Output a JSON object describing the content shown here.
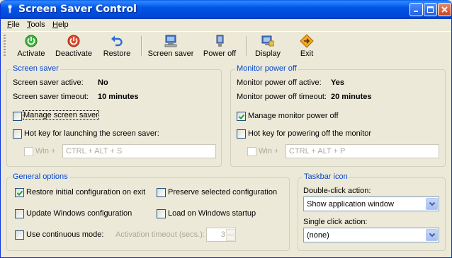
{
  "window": {
    "title": "Screen Saver Control"
  },
  "menu": [
    {
      "label": "File",
      "key": "F",
      "rest": "ile"
    },
    {
      "label": "Tools",
      "key": "T",
      "rest": "ools"
    },
    {
      "label": "Help",
      "key": "H",
      "rest": "elp"
    }
  ],
  "toolbar": {
    "activate": "Activate",
    "deactivate": "Deactivate",
    "restore": "Restore",
    "screen_saver": "Screen saver",
    "power_off": "Power off",
    "display": "Display",
    "exit": "Exit"
  },
  "screen_saver": {
    "legend": "Screen saver",
    "active_label": "Screen saver active:",
    "active_value": "No",
    "timeout_label": "Screen saver timeout:",
    "timeout_value": "10 minutes",
    "manage_label": "Manage screen saver",
    "manage_checked": false,
    "hotkey_label": "Hot key for launching the screen saver:",
    "hotkey_checked": false,
    "win_label": "Win +",
    "hotkey_value": "CTRL + ALT + S"
  },
  "monitor": {
    "legend": "Monitor power off",
    "active_label": "Monitor power off active:",
    "active_value": "Yes",
    "timeout_label": "Monitor power off timeout:",
    "timeout_value": "20 minutes",
    "manage_label": "Manage monitor power off",
    "manage_checked": true,
    "hotkey_label": "Hot key for powering off the monitor",
    "hotkey_checked": false,
    "win_label": "Win +",
    "hotkey_value": "CTRL + ALT + P"
  },
  "general": {
    "legend": "General options",
    "restore_label": "Restore initial configuration on exit",
    "restore_checked": true,
    "preserve_label": "Preserve selected configuration",
    "preserve_checked": false,
    "update_label": "Update Windows configuration",
    "update_checked": false,
    "startup_label": "Load on Windows startup",
    "startup_checked": false,
    "continuous_label": "Use continuous mode:",
    "continuous_checked": false,
    "timeout_label": "Activation timeout (secs.):",
    "timeout_value": "3"
  },
  "taskbar": {
    "legend": "Taskbar icon",
    "double_click_label": "Double-click action:",
    "double_click_value": "Show application window",
    "single_click_label": "Single click action:",
    "single_click_value": "(none)"
  },
  "colors": {
    "titlebar": "#0055E5",
    "group_legend": "#0046D5",
    "face": "#ECE9D8"
  }
}
